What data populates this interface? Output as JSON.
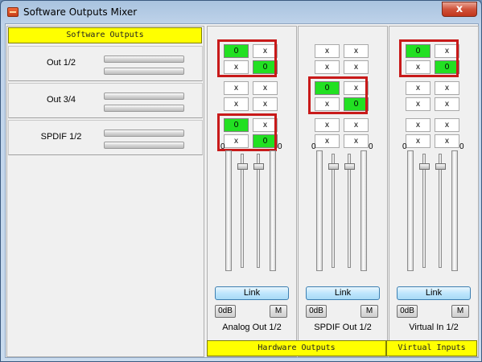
{
  "window": {
    "title": "Software Outputs Mixer",
    "close_label": "x"
  },
  "software_outputs": {
    "header": "Software Outputs",
    "rows": [
      {
        "label": "Out 1/2"
      },
      {
        "label": "Out 3/4"
      },
      {
        "label": "SPDIF 1/2"
      }
    ]
  },
  "strips": [
    {
      "name": "Analog Out 1/2",
      "matrix": [
        [
          "0",
          "x",
          "x",
          "0"
        ],
        [
          "x",
          "x",
          "x",
          "x"
        ],
        [
          "0",
          "x",
          "x",
          "0"
        ]
      ],
      "left_level": "0",
      "right_level": "0",
      "link_label": "Link",
      "zero_db_label": "0dB",
      "mono_label": "M"
    },
    {
      "name": "SPDIF Out 1/2",
      "matrix": [
        [
          "x",
          "x",
          "x",
          "x"
        ],
        [
          "0",
          "x",
          "x",
          "0"
        ],
        [
          "x",
          "x",
          "x",
          "x"
        ]
      ],
      "left_level": "0",
      "right_level": "0",
      "link_label": "Link",
      "zero_db_label": "0dB",
      "mono_label": "M"
    },
    {
      "name": "Virtual In 1/2",
      "matrix": [
        [
          "0",
          "x",
          "x",
          "0"
        ],
        [
          "x",
          "x",
          "x",
          "x"
        ],
        [
          "x",
          "x",
          "x",
          "x"
        ]
      ],
      "left_level": "0",
      "right_level": "0",
      "link_label": "Link",
      "zero_db_label": "0dB",
      "mono_label": "M"
    }
  ],
  "footer": {
    "hardware_outputs": "Hardware Outputs",
    "virtual_inputs": "Virtual Inputs"
  },
  "colors": {
    "active_cell": "#22e022",
    "header_yellow": "#ffff00",
    "highlight_box": "#c81a1a"
  }
}
